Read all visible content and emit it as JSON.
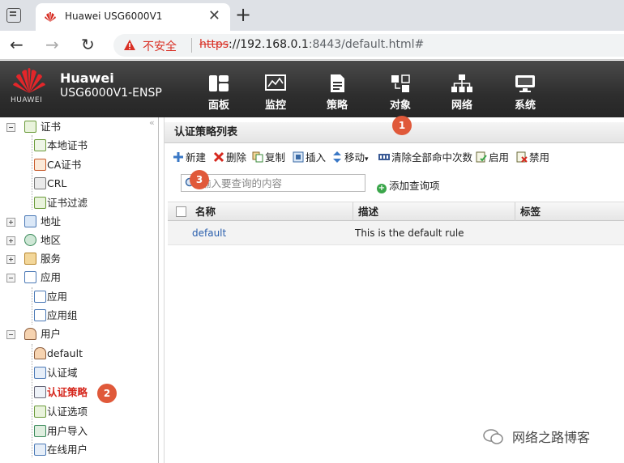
{
  "browser": {
    "tab_title": "Huawei USG6000V1",
    "tab_close": "✕",
    "new_tab": "+",
    "back": "←",
    "forward": "→",
    "reload": "↻",
    "security_label": "不安全",
    "url_scheme": "https",
    "url_host": "://192.168.0.1",
    "url_rest": ":8443/default.html#"
  },
  "header": {
    "logo_text": "HUAWEI",
    "brand": "Huawei",
    "model": "USG6000V1-ENSP",
    "nav": [
      {
        "label": "面板",
        "icon": "dashboard-icon"
      },
      {
        "label": "监控",
        "icon": "monitor-icon"
      },
      {
        "label": "策略",
        "icon": "policy-icon"
      },
      {
        "label": "对象",
        "icon": "object-icon"
      },
      {
        "label": "网络",
        "icon": "network-icon"
      },
      {
        "label": "系统",
        "icon": "system-icon"
      }
    ],
    "active_nav": "对象"
  },
  "sidebar": {
    "collapse_label": "«",
    "items": [
      {
        "label": "证书",
        "level": 0,
        "toggle": "minus"
      },
      {
        "label": "本地证书",
        "level": 1
      },
      {
        "label": "CA证书",
        "level": 1
      },
      {
        "label": "CRL",
        "level": 1
      },
      {
        "label": "证书过滤",
        "level": 1
      },
      {
        "label": "地址",
        "level": 0,
        "toggle": "plus"
      },
      {
        "label": "地区",
        "level": 0,
        "toggle": "plus"
      },
      {
        "label": "服务",
        "level": 0,
        "toggle": "plus"
      },
      {
        "label": "应用",
        "level": 0,
        "toggle": "minus"
      },
      {
        "label": "应用",
        "level": 1
      },
      {
        "label": "应用组",
        "level": 1
      },
      {
        "label": "用户",
        "level": 0,
        "toggle": "minus"
      },
      {
        "label": "default",
        "level": 1
      },
      {
        "label": "认证域",
        "level": 1
      },
      {
        "label": "认证策略",
        "level": 1,
        "active": true
      },
      {
        "label": "认证选项",
        "level": 1
      },
      {
        "label": "用户导入",
        "level": 1
      },
      {
        "label": "在线用户",
        "level": 1
      }
    ]
  },
  "badges": [
    "1",
    "2",
    "3"
  ],
  "content": {
    "title": "认证策略列表",
    "toolbar": {
      "new": "新建",
      "delete": "删除",
      "copy": "复制",
      "insert": "插入",
      "move": "移动",
      "clear_hits": "清除全部命中次数",
      "enable": "启用",
      "disable": "禁用"
    },
    "search": {
      "placeholder": "输入要查询的内容",
      "add_query": "添加查询项"
    },
    "columns": [
      "名称",
      "描述",
      "标签"
    ],
    "rows": [
      {
        "name": "default",
        "description": "This is the default rule",
        "tag": ""
      }
    ]
  },
  "watermark": "网络之路博客",
  "colors": {
    "accent_red": "#d6281e",
    "badge": "#e0593a",
    "link": "#2a5fad",
    "header_bg": "#2e2e2e"
  }
}
